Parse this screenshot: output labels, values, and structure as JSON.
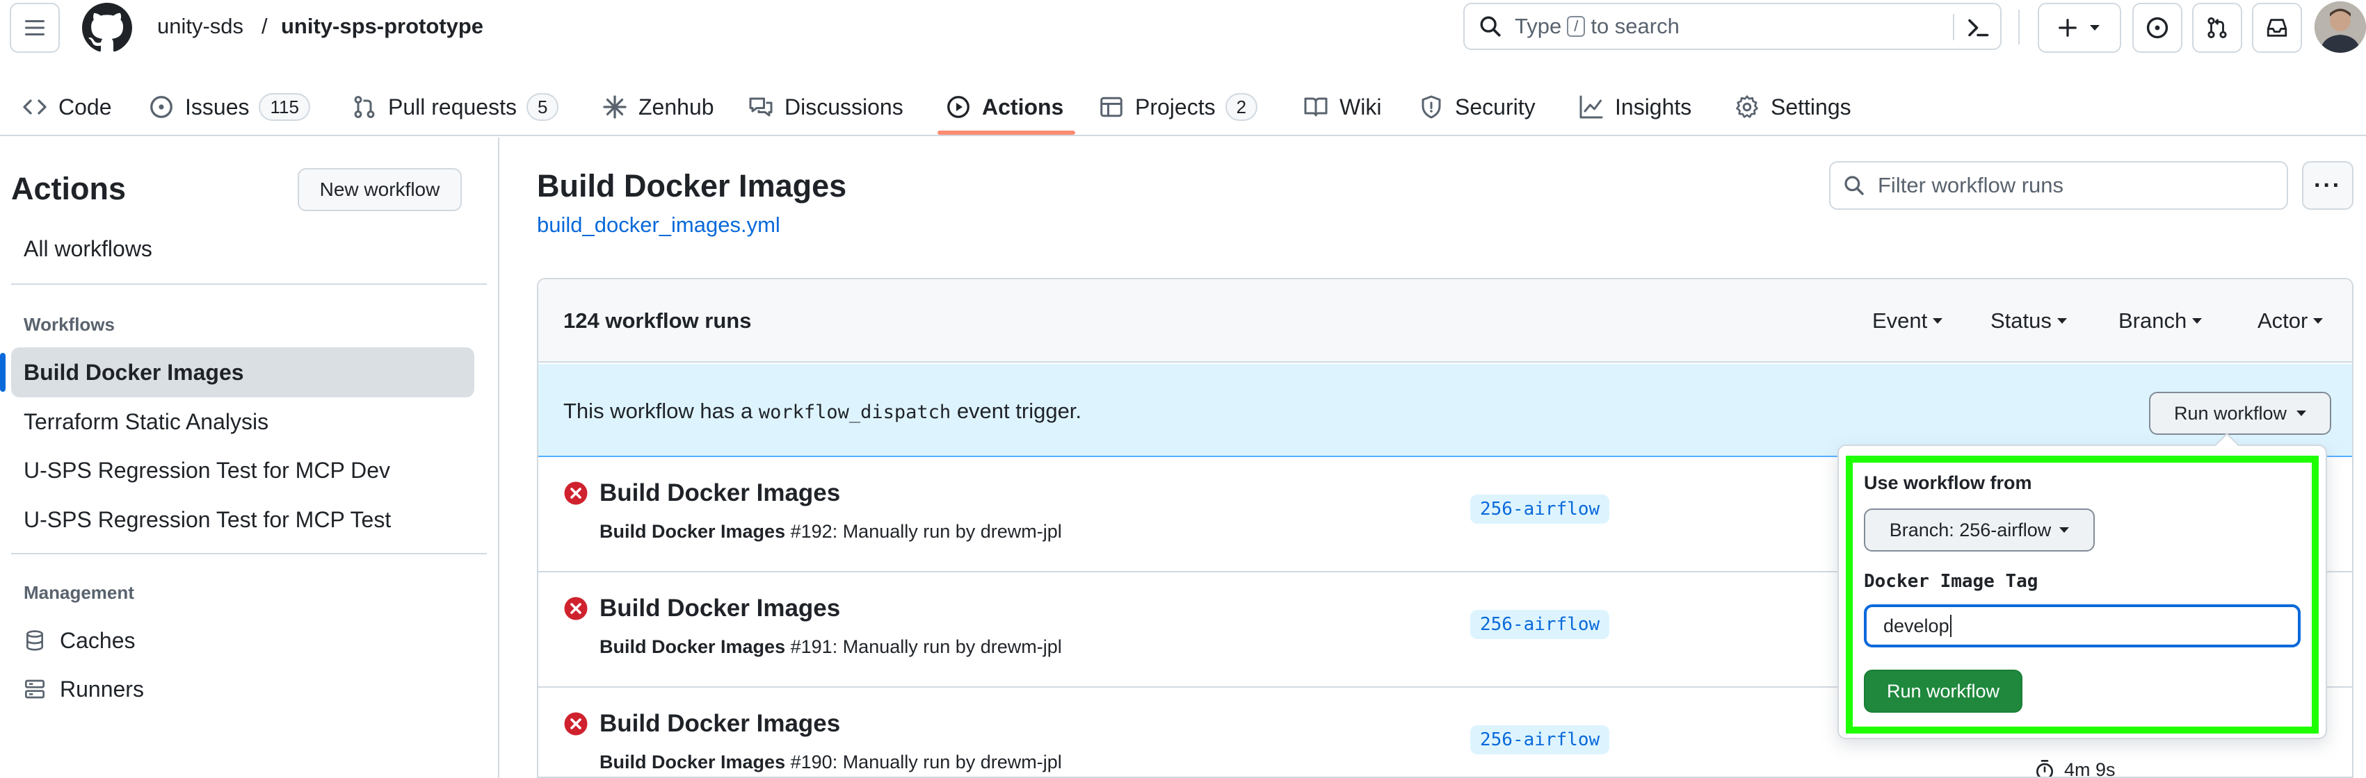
{
  "header": {
    "repo_owner": "unity-sds",
    "repo_separator": "/",
    "repo_name": "unity-sps-prototype",
    "search": {
      "prefix": "Type",
      "kbd": "/",
      "suffix": "to search"
    }
  },
  "tabs": [
    {
      "label": "Code",
      "icon": "code-icon"
    },
    {
      "label": "Issues",
      "icon": "issue-icon",
      "count": "115"
    },
    {
      "label": "Pull requests",
      "icon": "pull-request-icon",
      "count": "5"
    },
    {
      "label": "Zenhub",
      "icon": "zenhub-icon"
    },
    {
      "label": "Discussions",
      "icon": "discussions-icon"
    },
    {
      "label": "Actions",
      "icon": "play-icon",
      "active": true
    },
    {
      "label": "Projects",
      "icon": "table-icon",
      "count": "2"
    },
    {
      "label": "Wiki",
      "icon": "book-icon"
    },
    {
      "label": "Security",
      "icon": "shield-icon"
    },
    {
      "label": "Insights",
      "icon": "graph-icon"
    },
    {
      "label": "Settings",
      "icon": "gear-icon"
    }
  ],
  "sidebar": {
    "title": "Actions",
    "new_workflow": "New workflow",
    "all_workflows": "All workflows",
    "workflows_heading": "Workflows",
    "workflows": [
      {
        "label": "Build Docker Images",
        "active": true
      },
      {
        "label": "Terraform Static Analysis"
      },
      {
        "label": "U-SPS Regression Test for MCP Dev"
      },
      {
        "label": "U-SPS Regression Test for MCP Test"
      }
    ],
    "management_heading": "Management",
    "management": [
      {
        "label": "Caches",
        "icon": "database-icon"
      },
      {
        "label": "Runners",
        "icon": "server-icon"
      }
    ]
  },
  "main": {
    "title": "Build Docker Images",
    "file": "build_docker_images.yml",
    "filter_placeholder": "Filter workflow runs",
    "kebab": "···",
    "runs_count": "124 workflow runs",
    "facets": [
      "Event",
      "Status",
      "Branch",
      "Actor"
    ],
    "dispatch": {
      "prefix": "This workflow has a",
      "code": "workflow_dispatch",
      "suffix": "event trigger.",
      "button": "Run workflow"
    },
    "runs": [
      {
        "title": "Build Docker Images",
        "workflow": "Build Docker Images",
        "number": "#192",
        "detail": ": Manually run by drewm-jpl",
        "branch": "256-airflow",
        "status": "failure"
      },
      {
        "title": "Build Docker Images",
        "workflow": "Build Docker Images",
        "number": "#191",
        "detail": ": Manually run by drewm-jpl",
        "branch": "256-airflow",
        "status": "failure"
      },
      {
        "title": "Build Docker Images",
        "workflow": "Build Docker Images",
        "number": "#190",
        "detail": ": Manually run by drewm-jpl",
        "branch": "256-airflow",
        "status": "failure",
        "duration": "4m 9s"
      }
    ]
  },
  "popover": {
    "use_from_label": "Use workflow from",
    "branch_button": "Branch: 256-airflow",
    "field_label": "Docker Image Tag",
    "field_value": "develop",
    "submit": "Run workflow"
  },
  "colors": {
    "accent": "#0969da",
    "danger": "#cf222e",
    "success": "#1f883d",
    "highlight": "#1eff00",
    "active_tab_underline": "#fd8c73"
  }
}
